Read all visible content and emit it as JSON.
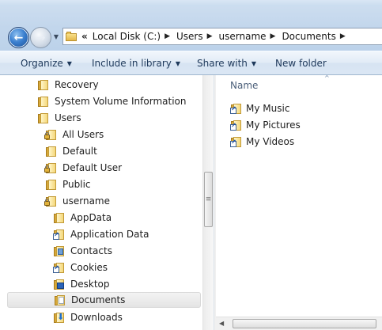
{
  "address": {
    "overflow_glyph": "«",
    "crumbs": [
      "Local Disk (C:)",
      "Users",
      "username",
      "Documents"
    ]
  },
  "toolbar": {
    "organize": "Organize",
    "include_in_library": "Include in library",
    "share_with": "Share with",
    "new_folder": "New folder"
  },
  "nav_tree": [
    {
      "label": "Recovery",
      "icon": "folder-icon",
      "level": 1
    },
    {
      "label": "System Volume Information",
      "icon": "folder-icon",
      "level": 1
    },
    {
      "label": "Users",
      "icon": "folder-icon",
      "level": 1
    },
    {
      "label": "All Users",
      "icon": "locked-folder-icon",
      "level": 2
    },
    {
      "label": "Default",
      "icon": "folder-icon",
      "level": 2
    },
    {
      "label": "Default User",
      "icon": "locked-folder-icon",
      "level": 2
    },
    {
      "label": "Public",
      "icon": "folder-icon",
      "level": 2
    },
    {
      "label": "username",
      "icon": "locked-folder-icon",
      "level": 2
    },
    {
      "label": "AppData",
      "icon": "folder-icon",
      "level": 3
    },
    {
      "label": "Application Data",
      "icon": "shortcut-folder-icon",
      "level": 3
    },
    {
      "label": "Contacts",
      "icon": "contacts-folder-icon",
      "level": 3
    },
    {
      "label": "Cookies",
      "icon": "shortcut-folder-icon",
      "level": 3
    },
    {
      "label": "Desktop",
      "icon": "desktop-folder-icon",
      "level": 3
    },
    {
      "label": "Documents",
      "icon": "documents-folder-icon",
      "level": 3,
      "selected": true
    },
    {
      "label": "Downloads",
      "icon": "downloads-folder-icon",
      "level": 3
    }
  ],
  "content": {
    "column_name": "Name",
    "items": [
      {
        "label": "My Music",
        "icon": "shortcut-folder-icon"
      },
      {
        "label": "My Pictures",
        "icon": "shortcut-folder-icon"
      },
      {
        "label": "My Videos",
        "icon": "shortcut-folder-icon"
      }
    ]
  }
}
